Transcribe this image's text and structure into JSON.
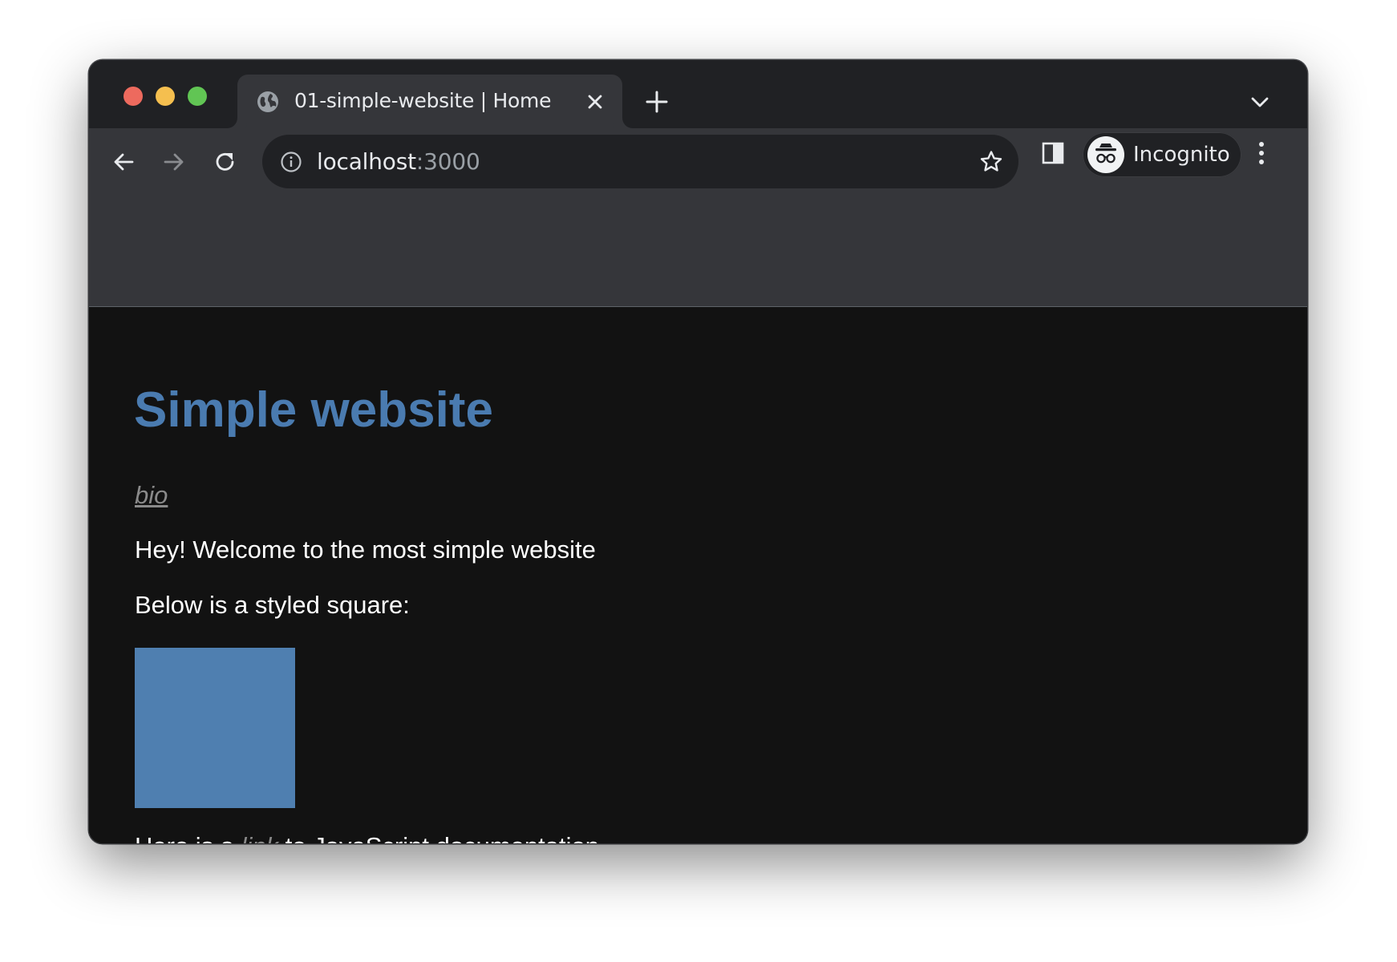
{
  "browser": {
    "tab": {
      "title": "01-simple-website | Home",
      "favicon": "globe-icon"
    },
    "address_bar": {
      "host": "localhost",
      "port": ":3000"
    },
    "profile": {
      "label": "Incognito",
      "icon": "incognito-icon"
    },
    "colors": {
      "tabstrip": "#202124",
      "toolbar": "#35363a",
      "omnibox": "#202124",
      "traffic_close": "#ed6a5e",
      "traffic_minimize": "#f5bf4f",
      "traffic_zoom": "#61c554"
    }
  },
  "page": {
    "title": "Simple website",
    "bio_link": "bio",
    "welcome": "Hey! Welcome to the most simple website",
    "square_intro": "Below is a styled square:",
    "footer_before": "Here is a ",
    "footer_link": "link",
    "footer_after": " to JavaScript documentation",
    "colors": {
      "background": "#121212",
      "title": "#4a7bb0",
      "square": "#4f7fb0",
      "link": "#8a8a8a"
    }
  }
}
